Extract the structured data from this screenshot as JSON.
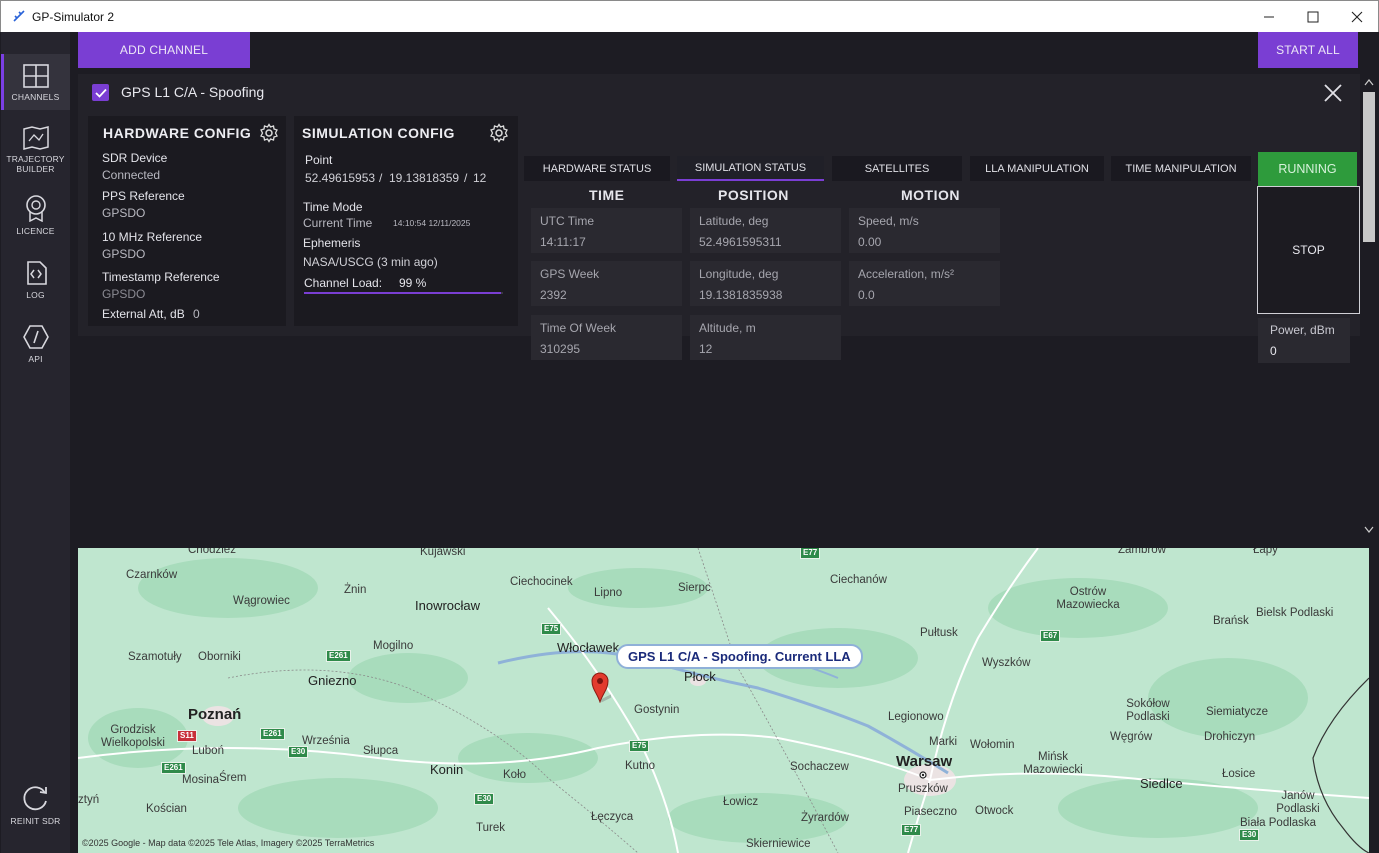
{
  "window": {
    "title": "GP-Simulator 2"
  },
  "colors": {
    "accent": "#7a3ed3",
    "running": "#2e9b3c",
    "panel": "#232229"
  },
  "sidebar": {
    "items": [
      {
        "label": "CHANNELS",
        "icon": "channels-icon"
      },
      {
        "label": "TRAJECTORY",
        "label2": "BUILDER",
        "icon": "trajectory-icon"
      },
      {
        "label": "LICENCE",
        "icon": "licence-icon"
      },
      {
        "label": "LOG",
        "icon": "log-icon"
      },
      {
        "label": "API",
        "icon": "api-icon"
      },
      {
        "label": "REINIT SDR",
        "icon": "reinit-icon"
      }
    ]
  },
  "toolbar": {
    "add_channel": "ADD CHANNEL",
    "start_all": "START ALL"
  },
  "channel": {
    "title": "GPS L1 C/A - Spoofing",
    "checked": true,
    "hardware": {
      "heading": "HARDWARE CONFIG",
      "sdr_label": "SDR Device",
      "sdr_value": "Connected",
      "pps_label": "PPS Reference",
      "pps_value": "GPSDO",
      "mhz_label": "10 MHz Reference",
      "mhz_value": "GPSDO",
      "ts_label": "Timestamp Reference",
      "ts_value": "GPSDO",
      "att_label": "External Att, dB",
      "att_value": "0"
    },
    "simulation": {
      "heading": "SIMULATION CONFIG",
      "point_label": "Point",
      "lat": "52.49615953",
      "sep1": "/",
      "lon": "19.13818359",
      "sep2": "/",
      "alt": "12",
      "time_mode_label": "Time Mode",
      "time_mode_value": "Current Time",
      "time_stamp": "14:10:54  12/11/2025",
      "ephemeris_label": "Ephemeris",
      "ephemeris_value": "NASA/USCG (3 min ago)",
      "load_label": "Channel Load:",
      "load_value": "99 %",
      "load_fraction": 0.99
    },
    "tabs": [
      {
        "label": "HARDWARE STATUS"
      },
      {
        "label": "SIMULATION STATUS",
        "active": true
      },
      {
        "label": "SATELLITES"
      },
      {
        "label": "LLA MANIPULATION"
      },
      {
        "label": "TIME MANIPULATION"
      }
    ],
    "status": {
      "running": "RUNNING",
      "stop": "STOP",
      "power_label": "Power, dBm",
      "power_value": "0"
    },
    "columns": {
      "time": "TIME",
      "position": "POSITION",
      "motion": "MOTION"
    },
    "time": [
      {
        "label": "UTC Time",
        "value": "14:11:17"
      },
      {
        "label": "GPS Week",
        "value": "2392"
      },
      {
        "label": "Time Of Week",
        "value": "310295"
      }
    ],
    "position": [
      {
        "label": "Latitude, deg",
        "value": "52.4961595311"
      },
      {
        "label": "Longitude, deg",
        "value": "19.1381835938"
      },
      {
        "label": "Altitude, m",
        "value": "12"
      }
    ],
    "motion": [
      {
        "label": "Speed, m/s",
        "value": "0.00"
      },
      {
        "label": "Acceleration, m/s²",
        "value": "0.0"
      }
    ]
  },
  "map": {
    "marker_label": "GPS L1 C/A - Spoofing. Current LLA",
    "attribution": "©2025 Google - Map data ©2025 Tele Atlas, Imagery ©2025 TerraMetrics",
    "places": [
      "Chodzież",
      "Kujawski",
      "Czarnków",
      "Ciechocinek",
      "Lipno",
      "Sierpc",
      "Ciechanów",
      "Zambrów",
      "Łapy",
      "Wągrowiec",
      "Żnin",
      "Inowrocław",
      "Ostrów Mazowiecka",
      "Bielsk Podlaski",
      "Brańsk",
      "Szamotuły",
      "Oborniki",
      "Mogilno",
      "Włocławek",
      "Pułtusk",
      "Wyszków",
      "Gniezno",
      "Płock",
      "Poznań",
      "Gostynin",
      "Legionowo",
      "Sokółow Podlaski",
      "Siemiatycze",
      "Grodzisk Wielkopolski",
      "Września",
      "Słupca",
      "Konin",
      "Marki",
      "Wołomin",
      "Węgrów",
      "Drohiczyn",
      "Luboń",
      "Kutno",
      "Sochaczew",
      "Warsaw",
      "Mińsk Mazowiecki",
      "Siedlce",
      "Łosice",
      "Mosina",
      "Śrem",
      "Koło",
      "Pruszków",
      "Kościan",
      "Łowicz",
      "Piaseczno",
      "Otwock",
      "Janów Podlaski",
      "Turek",
      "Łęczyca",
      "Żyrardów",
      "Biała Podlaska",
      "Skierniewice",
      "ztyń"
    ],
    "roads": [
      "E77",
      "E75",
      "E261",
      "E67",
      "S11",
      "E261",
      "E30",
      "E261",
      "E75",
      "E30",
      "E77",
      "E30"
    ]
  }
}
